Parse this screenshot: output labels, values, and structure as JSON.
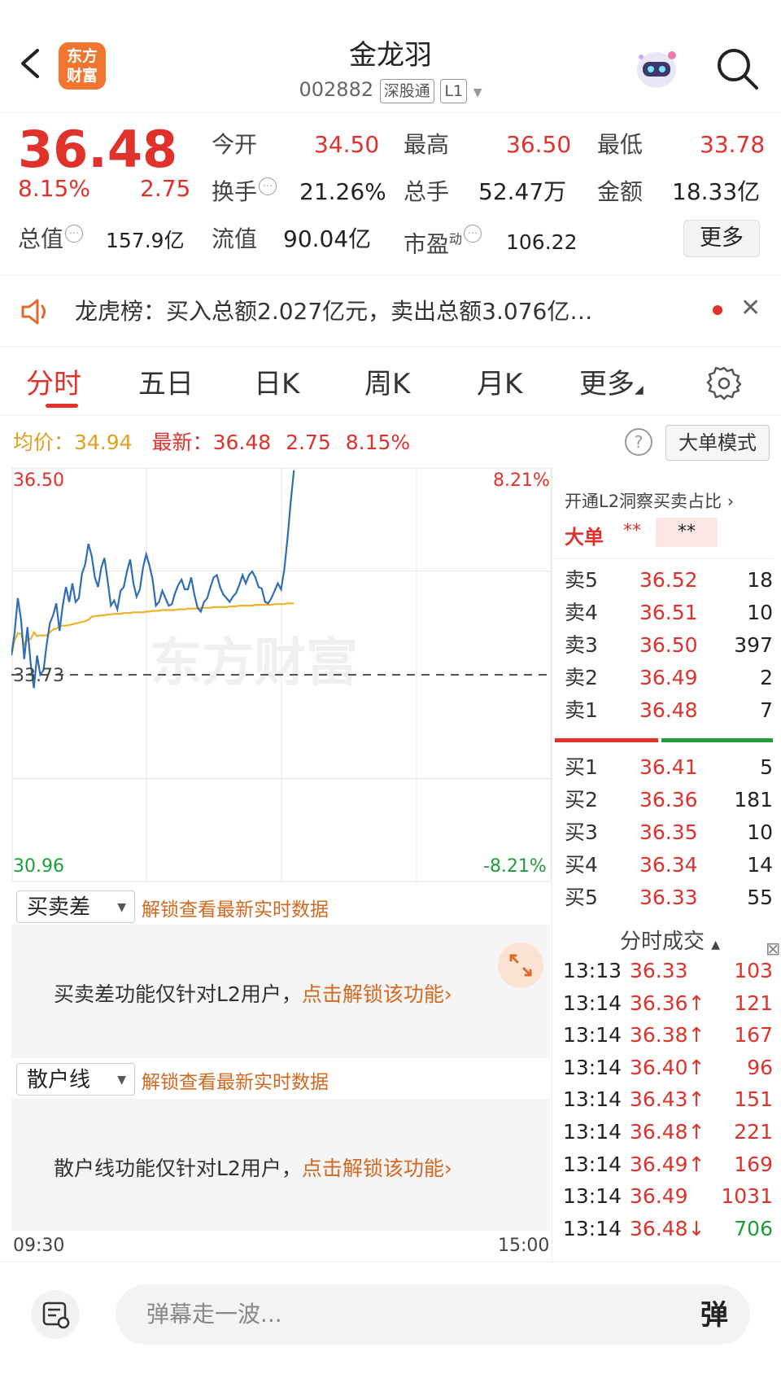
{
  "header": {
    "logo_line1": "东方",
    "logo_line2": "财富",
    "stock_name": "金龙羽",
    "stock_code": "002882",
    "tag_connect": "深股通",
    "tag_level": "L1"
  },
  "quote": {
    "price": "36.48",
    "change_pct": "8.15%",
    "change_amt": "2.75",
    "open_label": "今开",
    "open": "34.50",
    "high_label": "最高",
    "high": "36.50",
    "low_label": "最低",
    "low": "33.78",
    "turnover_label": "换手",
    "turnover": "21.26%",
    "volume_label": "总手",
    "volume": "52.47万",
    "amount_label": "金额",
    "amount": "18.33亿",
    "mktcap_label": "总值",
    "mktcap": "157.9亿",
    "float_label": "流值",
    "float_cap": "90.04亿",
    "pe_label": "市盈",
    "pe_sup": "动",
    "pe": "106.22",
    "more_button": "更多"
  },
  "notice": {
    "text": "龙虎榜：买入总额2.027亿元，卖出总额3.076亿…"
  },
  "tabs": [
    {
      "label": "分时"
    },
    {
      "label": "五日"
    },
    {
      "label": "日K"
    },
    {
      "label": "周K"
    },
    {
      "label": "月K"
    },
    {
      "label": "更多"
    }
  ],
  "infoline": {
    "avg_label": "均价：",
    "avg": "34.94",
    "latest_label": "最新：",
    "latest": "36.48",
    "chg": "2.75",
    "chg_pct": "8.15%",
    "help": "?",
    "bigmode": "大单模式"
  },
  "chart_data": {
    "type": "line",
    "title": "",
    "y_top_label": "36.50",
    "y_mid_label": "33.73",
    "y_bottom_label": "30.96",
    "pct_top_label": "8.21%",
    "pct_bottom_label": "-8.21%",
    "x_start_label": "09:30",
    "x_end_label": "15:00",
    "watermark": "东方财富",
    "ylim": [
      30.96,
      36.5
    ],
    "prev_close": 33.73,
    "series": [
      {
        "values": [
          33.99,
          34.29,
          34.76,
          34.48,
          33.94,
          34.37,
          33.88,
          33.55,
          33.99,
          33.73,
          33.79,
          34.14,
          34.43,
          34.53,
          34.69,
          34.32,
          34.66,
          34.91,
          34.71,
          34.96,
          34.71,
          34.76,
          35.09,
          35.22,
          35.49,
          35.33,
          35.04,
          34.91,
          35.17,
          35.3,
          34.99,
          34.66,
          34.73,
          34.61,
          34.86,
          34.91,
          35.12,
          35.28,
          34.96,
          34.78,
          34.88,
          35.17,
          35.35,
          35.2,
          35.01,
          34.66,
          34.71,
          34.86,
          34.76,
          34.66,
          34.68,
          34.83,
          34.94,
          35.01,
          34.88,
          34.88,
          35.04,
          34.81,
          34.63,
          34.58,
          34.71,
          34.76,
          34.91,
          35.04,
          35.07,
          34.91,
          34.81,
          34.76,
          34.71,
          34.78,
          34.83,
          34.94,
          35.07,
          34.96,
          35.07,
          35.12,
          35.04,
          34.91,
          34.89,
          34.71,
          34.69,
          34.76,
          34.86,
          34.96,
          34.88,
          35.14,
          35.56,
          36.05,
          36.48
        ],
        "color": "#2f6db5"
      },
      {
        "values": [
          33.99,
          34.19,
          34.29,
          34.28,
          34.14,
          34.2,
          34.21,
          34.3,
          34.25,
          34.26,
          34.26,
          34.26,
          34.3,
          34.34,
          34.35,
          34.38,
          34.39,
          34.39,
          34.4,
          34.41,
          34.42,
          34.43,
          34.44,
          34.45,
          34.47,
          34.51,
          34.52,
          34.52,
          34.53,
          34.53,
          34.54,
          34.54,
          34.55,
          34.55,
          34.55,
          34.56,
          34.56,
          34.56,
          34.57,
          34.57,
          34.57,
          34.57,
          34.58,
          34.58,
          34.59,
          34.59,
          34.59,
          34.6,
          34.6,
          34.6,
          34.6,
          34.6,
          34.61,
          34.61,
          34.61,
          34.62,
          34.62,
          34.62,
          34.62,
          34.63,
          34.63,
          34.63,
          34.63,
          34.64,
          34.64,
          34.64,
          34.64,
          34.64,
          34.65,
          34.65,
          34.65,
          34.66,
          34.66,
          34.66,
          34.66,
          34.66,
          34.67,
          34.67,
          34.67,
          34.67,
          34.67,
          34.67,
          34.68,
          34.68,
          34.68,
          34.68,
          34.69,
          34.69,
          34.69
        ],
        "color": "#f0b12a"
      }
    ],
    "points_per_session": 240
  },
  "sub1": {
    "select": "买卖差",
    "unlock": "解锁查看最新实时数据",
    "desc": "买卖差功能仅针对L2用户，",
    "link": "点击解锁该功能"
  },
  "sub2": {
    "select": "散户线",
    "unlock": "解锁查看最新实时数据",
    "desc": "散户线功能仅针对L2用户，",
    "link": "点击解锁该功能"
  },
  "orderbook": {
    "promo": "开通L2洞察买卖占比",
    "big_label": "大单",
    "big_val1": "**",
    "big_val2": "**",
    "asks": [
      {
        "label": "卖5",
        "price": "36.52",
        "vol": "18"
      },
      {
        "label": "卖4",
        "price": "36.51",
        "vol": "10"
      },
      {
        "label": "卖3",
        "price": "36.50",
        "vol": "397"
      },
      {
        "label": "卖2",
        "price": "36.49",
        "vol": "2"
      },
      {
        "label": "卖1",
        "price": "36.48",
        "vol": "7"
      }
    ],
    "bids": [
      {
        "label": "买1",
        "price": "36.41",
        "vol": "5"
      },
      {
        "label": "买2",
        "price": "36.36",
        "vol": "181"
      },
      {
        "label": "买3",
        "price": "36.35",
        "vol": "10"
      },
      {
        "label": "买4",
        "price": "36.34",
        "vol": "14"
      },
      {
        "label": "买5",
        "price": "36.33",
        "vol": "55"
      }
    ],
    "buy_ratio": 0.48
  },
  "trades": {
    "title": "分时成交",
    "rows": [
      {
        "time": "13:13",
        "price": "36.33",
        "vol": "103",
        "side": "buy"
      },
      {
        "time": "13:14",
        "price": "36.36↑",
        "vol": "121",
        "side": "buy"
      },
      {
        "time": "13:14",
        "price": "36.38↑",
        "vol": "167",
        "side": "buy"
      },
      {
        "time": "13:14",
        "price": "36.40↑",
        "vol": "96",
        "side": "buy"
      },
      {
        "time": "13:14",
        "price": "36.43↑",
        "vol": "151",
        "side": "buy"
      },
      {
        "time": "13:14",
        "price": "36.48↑",
        "vol": "221",
        "side": "buy"
      },
      {
        "time": "13:14",
        "price": "36.49↑",
        "vol": "169",
        "side": "buy"
      },
      {
        "time": "13:14",
        "price": "36.49",
        "vol": "1031",
        "side": "buy"
      },
      {
        "time": "13:14",
        "price": "36.48↓",
        "vol": "706",
        "side": "sell"
      }
    ]
  },
  "bottom": {
    "placeholder": "弹幕走一波...",
    "button": "弹"
  },
  "colors": {
    "up": "#e0312a",
    "down": "#1f9d3a",
    "brand": "#f0762f",
    "price_line": "#2f6db5",
    "avg_line": "#f0b12a"
  }
}
